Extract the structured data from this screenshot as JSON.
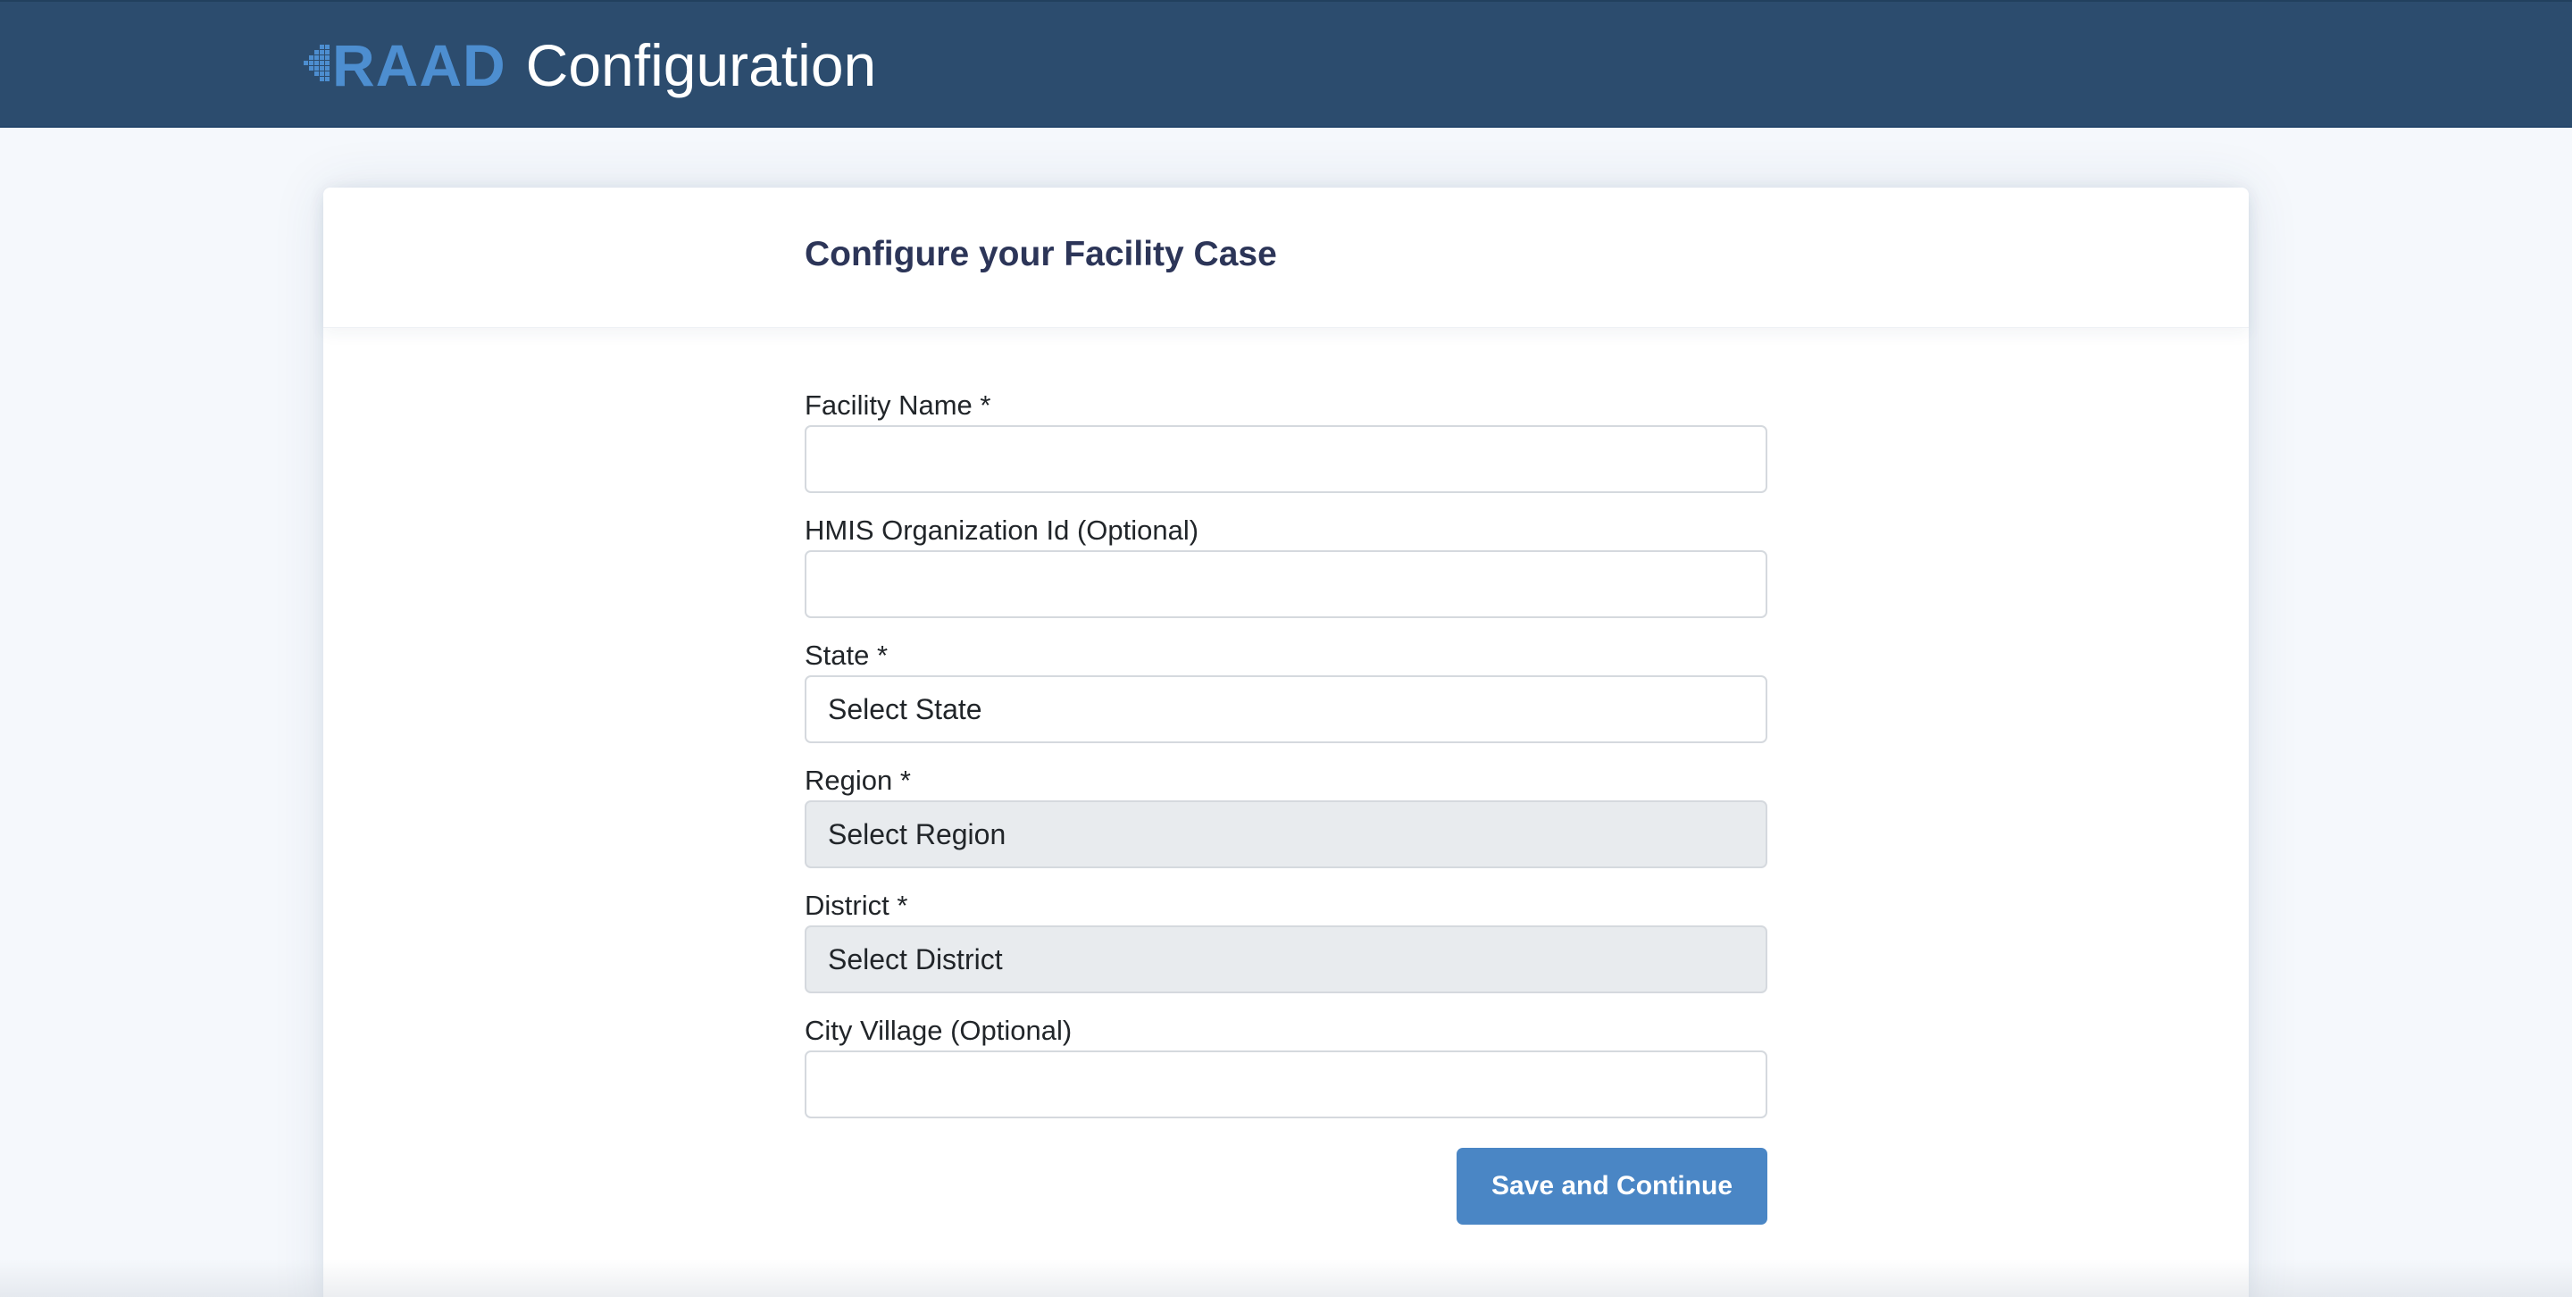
{
  "header": {
    "logo_text": "RAAD",
    "title": "Configuration"
  },
  "card": {
    "title": "Configure your Facility Case"
  },
  "form": {
    "facility_name": {
      "label": "Facility Name *",
      "value": ""
    },
    "hmis_org_id": {
      "label": "HMIS Organization Id (Optional)",
      "value": ""
    },
    "state": {
      "label": "State *",
      "selected": "Select State"
    },
    "region": {
      "label": "Region *",
      "selected": "Select Region"
    },
    "district": {
      "label": "District *",
      "selected": "Select District"
    },
    "city_village": {
      "label": "City Village (Optional)",
      "value": ""
    },
    "submit_label": "Save and Continue"
  },
  "colors": {
    "header_bg": "#2c4c6e",
    "logo_accent": "#4d8ed0",
    "button_bg": "#4a86c5",
    "title_text": "#2c3558",
    "disabled_bg": "#e8ebee"
  },
  "icons": {
    "logo": "raad-logo-icon"
  }
}
